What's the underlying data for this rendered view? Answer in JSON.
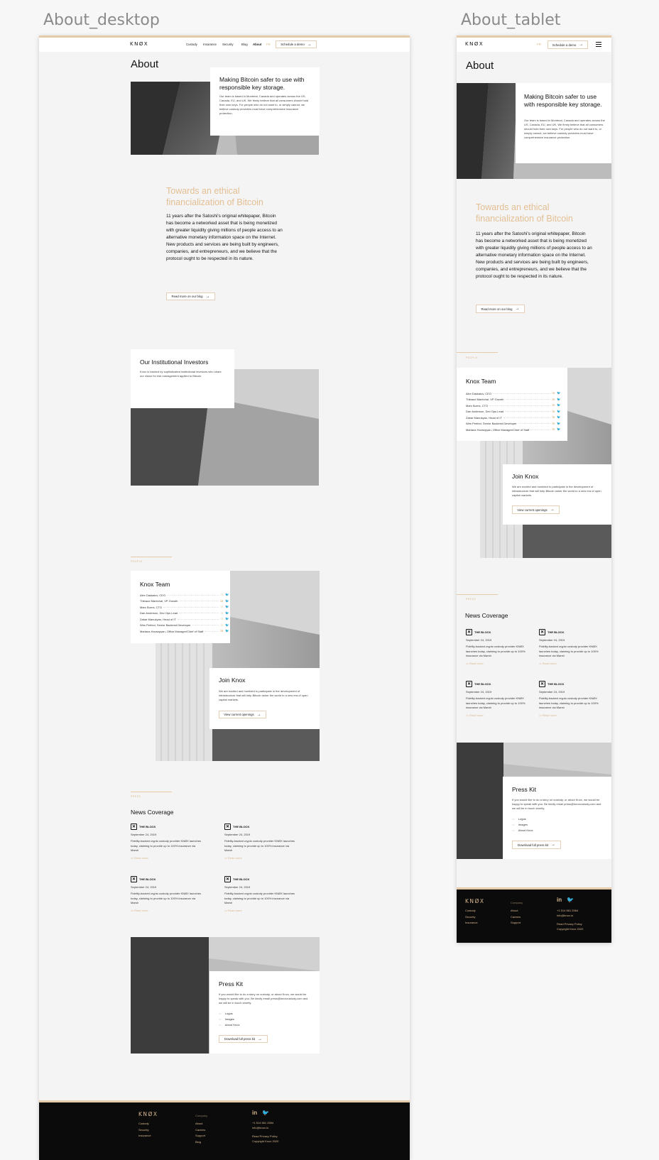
{
  "frames": {
    "desktop": "About_desktop",
    "tablet": "About_tablet"
  },
  "brand": {
    "logo": "KNØX",
    "accent": "#e6cba9",
    "dark": "#0b0b0b"
  },
  "nav": {
    "items": [
      "Custody",
      "Insurance",
      "Security",
      "Blog",
      "About"
    ],
    "active": "About",
    "lang": "FR",
    "cta": "Schedule a demo"
  },
  "about": {
    "title": "About",
    "card_title": "Making Bitcoin safer to use with responsible key storage.",
    "card_text": "Our team is based in Montreal, Canada and operates across the US, Canada, EU, and UK. We firmly believe that all consumers should hold their own keys. For people who do not want to, or simply cannot, we believe custody providers must have comprehensive insurance protection."
  },
  "ethical": {
    "title": "Towards an ethical financialization of Bitcoin",
    "body": "11 years after the Satoshi's original whitepaper, Bitcoin has become a networked asset that is being monetized with greater liquidity giving millions of people access to an alternative monetary information space on the Internet. New products and services are being built by engineers, companies, and entrepreneurs, and we believe that the protocol ought to be respected in its nature.",
    "button": "Read more on our blog"
  },
  "investors": {
    "title": "Our Institutional Investors",
    "text": "Knox is backed by sophisticated institutional investors who share our vision for risk management applied to Bitcoin."
  },
  "team": {
    "label": "PEOPLE",
    "title": "Knox Team",
    "members": [
      "Alex Daskalov, CEO",
      "Thibaud Maréchal, VP Growth",
      "Marc Burns, CTO",
      "Dan Anderson, Dev Ops Lead",
      "Zabar Manukyan, Head of IT",
      "Wes Perfect, Senior Backend Developer",
      "Mariana Hovsepyan, Office Manager/Chief of Staff"
    ],
    "social_in": "in",
    "social_tw": "🐦"
  },
  "join": {
    "title": "Join Knox",
    "text": "We are excited and humbled to participate in the development of infrastructure that will help Bitcoin usher the world to a new era of open capital markets.",
    "button": "View current openings"
  },
  "news": {
    "label": "PRESS",
    "title": "News Coverage",
    "items": [
      {
        "source": "THE BLOCK",
        "date": "September 24, 2019",
        "text": "Fidelity-backed crypto custody provider KNØX launches today, claiming to provide up to 100% insurance via Marsh",
        "more": "Read more"
      },
      {
        "source": "THE BLOCK",
        "date": "September 24, 2019",
        "text": "Fidelity-backed crypto custody provider KNØX launches today, claiming to provide up to 100% insurance via Marsh",
        "more": "Read more"
      },
      {
        "source": "THE BLOCK",
        "date": "September 24, 2019",
        "text": "Fidelity-backed crypto custody provider KNØX launches today, claiming to provide up to 100% insurance via Marsh",
        "more": "Read more"
      },
      {
        "source": "THE BLOCK",
        "date": "September 24, 2019",
        "text": "Fidelity-backed crypto custody provider KNØX launches today, claiming to provide up to 100% insurance via Marsh",
        "more": "Read more"
      }
    ]
  },
  "press": {
    "title": "Press Kit",
    "text": "If you would like to do a story on custody, or about Knox, we would be happy to speak with you. Be kindly email press@knoxcustody.com and we will be in touch shortly.",
    "items": [
      "Logos",
      "Images",
      "About Knox"
    ],
    "button": "Download full press kit"
  },
  "footer": {
    "logo": "KNØX",
    "col1": [
      "Custody",
      "Security",
      "Insurance"
    ],
    "company_head": "Company",
    "col2": [
      "About",
      "Careers",
      "Support",
      "Blog"
    ],
    "phone": "+1 514 561 2564",
    "email": "info@knox.io",
    "privacy": "Read Privacy Policy",
    "copyright": "Copyright Knox 2020",
    "social_in": "in",
    "social_tw": "🐦"
  }
}
